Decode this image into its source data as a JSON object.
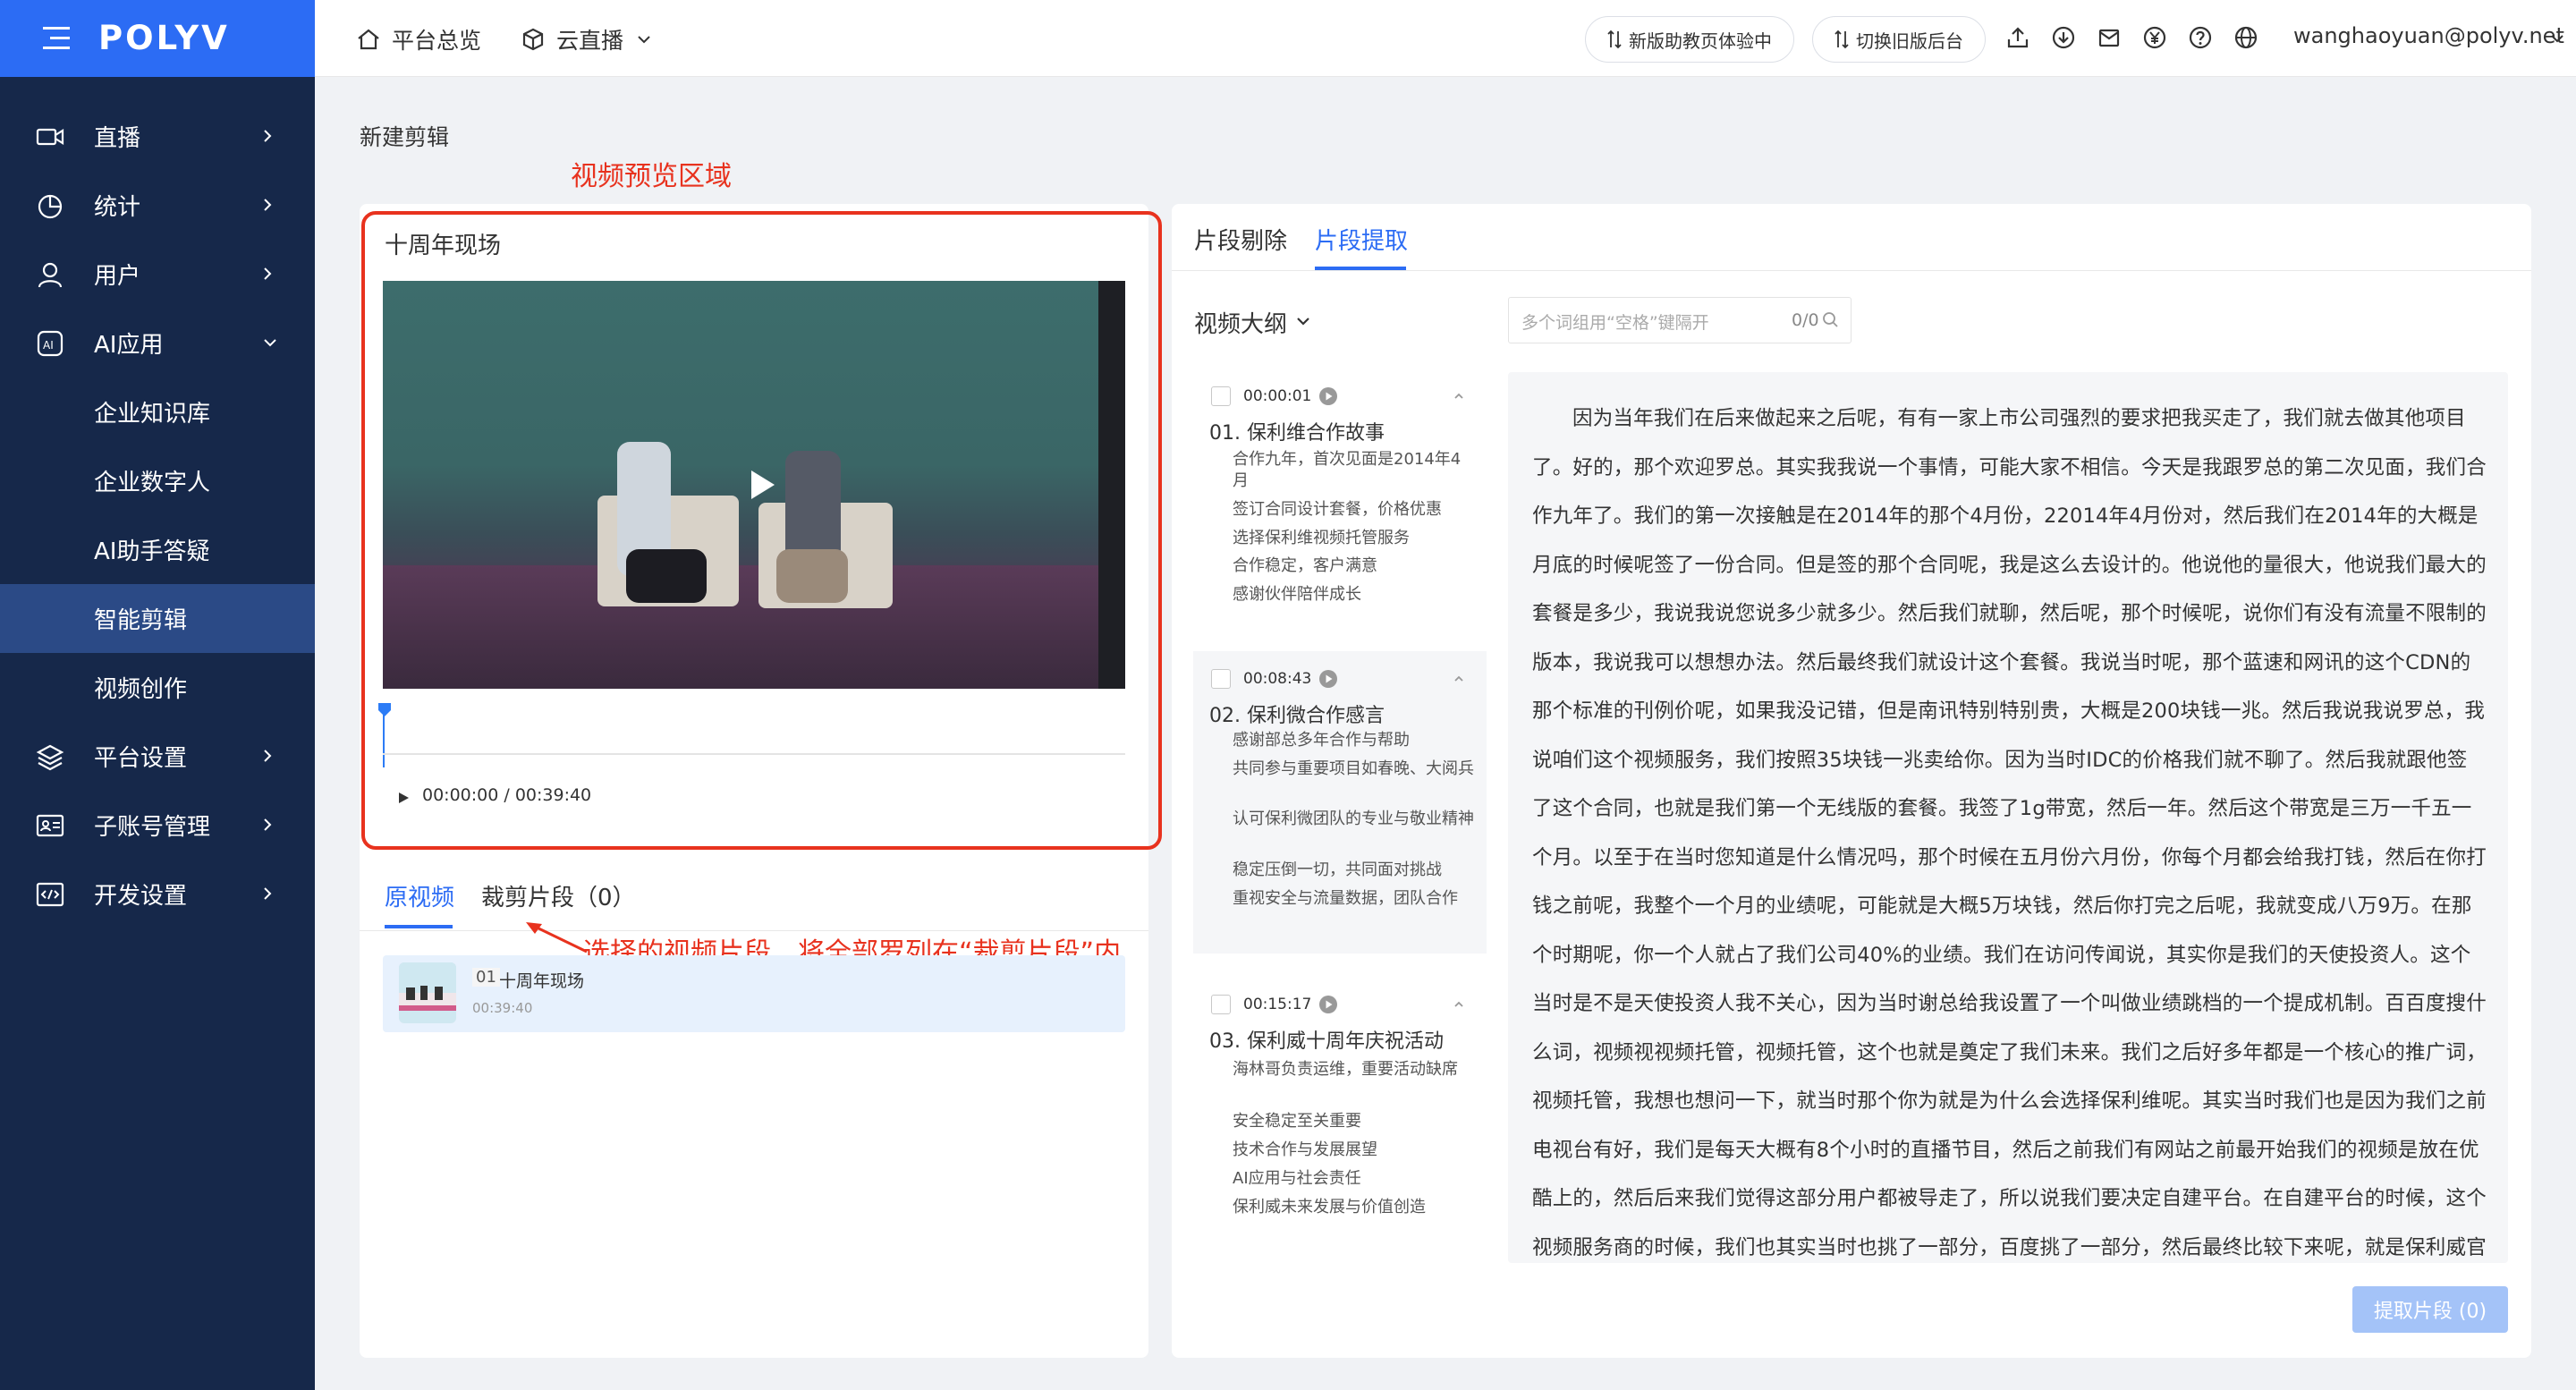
{
  "logo": "POLYV",
  "sidebar": {
    "items": [
      {
        "label": "直播"
      },
      {
        "label": "统计"
      },
      {
        "label": "用户"
      },
      {
        "label": "AI应用"
      },
      {
        "label": "企业知识库"
      },
      {
        "label": "企业数字人"
      },
      {
        "label": "AI助手答疑"
      },
      {
        "label": "智能剪辑"
      },
      {
        "label": "视频创作"
      },
      {
        "label": "平台设置"
      },
      {
        "label": "子账号管理"
      },
      {
        "label": "开发设置"
      }
    ],
    "active_item": "智能剪辑",
    "accent_color": "#2c6cf4",
    "bg_color": "#16284a"
  },
  "header": {
    "home": "平台总览",
    "cloud_live": "云直播",
    "new_home_btn": "新版助教页体验中",
    "switch_btn": "切换旧版后台",
    "email": "wanghaoyuan@polyv.net"
  },
  "page": {
    "title": "新建剪辑",
    "annotation_preview": "视频预览区域",
    "annotation_clips": "选择的视频片段，将全部罗列在“裁剪片段”内"
  },
  "player": {
    "video_title": "十周年现场",
    "timecode": "00:00:00 / 00:39:40",
    "progress": 0
  },
  "left_tabs": {
    "original": "原视频",
    "cut_clips": "裁剪片段（0）"
  },
  "clip": {
    "index": "01",
    "name": "十周年现场",
    "duration": "00:39:40"
  },
  "right_tabs": {
    "delete": "片段剔除",
    "extract": "片段提取"
  },
  "outline": {
    "title": "视频大纲",
    "search_placeholder": "多个词组用“空格”键隔开",
    "search_count": "0/0",
    "chapters": [
      {
        "time": "00:00:01",
        "title": "01. 保利维合作故事",
        "points": [
          "合作九年，首次见面是2014年4月",
          "签订合同设计套餐，价格优惠",
          "选择保利维视频托管服务",
          "合作稳定，客户满意",
          "感谢伙伴陪伴成长"
        ]
      },
      {
        "time": "00:08:43",
        "title": "02. 保利微合作感言",
        "points": [
          "感谢部总多年合作与帮助",
          "共同参与重要项目如春晚、大阅兵",
          "认可保利微团队的专业与敬业精神",
          "稳定压倒一切，共同面对挑战",
          "重视安全与流量数据，团队合作"
        ]
      },
      {
        "time": "00:15:17",
        "title": "03. 保利威十周年庆祝活动",
        "points": [
          "海林哥负责运维，重要活动缺席",
          "安全稳定至关重要",
          "技术合作与发展展望",
          "AI应用与社会责任",
          "保利威未来发展与价值创造"
        ]
      }
    ]
  },
  "transcript": {
    "text": "因为当年我们在后来做起来之后呢，有有一家上市公司强烈的要求把我买走了，我们就去做其他项目了。好的，那个欢迎罗总。其实我我说一个事情，可能大家不相信。今天是我跟罗总的第二次见面，我们合作九年了。我们的第一次接触是在2014年的那个4月份，22014年4月份对，然后我们在2014年的大概是月底的时候呢签了一份合同。但是签的那个合同呢，我是这么去设计的。他说他的量很大，他说我们最大的套餐是多少，我说我说您说多少就多少。然后我们就聊，然后呢，那个时候呢，说你们有没有流量不限制的版本，我说我可以想想办法。然后最终我们就设计这个套餐。我说当时呢，那个蓝速和网讯的这个CDN的那个标准的刊例价呢，如果我没记错，但是南讯特别特别贵，大概是200块钱一兆。然后我说我说罗总，我说咱们这个视频服务，我们按照35块钱一兆卖给你。因为当时IDC的价格我们就不聊了。然后我就跟他签了这个合同，也就是我们第一个无线版的套餐。我签了1g带宽，然后一年。然后这个带宽是三万一千五一个月。以至于在当时您知道是什么情况吗，那个时候在五月份六月份，你每个月都会给我打钱，然后在你打钱之前呢，我整个一个月的业绩呢，可能就是大概5万块钱，然后你打完之后呢，我就变成八万9万。在那个时期呢，你一个人就占了我们公司40%的业绩。我们在访问传闻说，其实你是我们的天使投资人。这个当时是不是天使投资人我不关心，因为当时谢总给我设置了一个叫做业绩跳档的一个提成机制。百百度搜什么词，视频视视频托管，视频托管，这个也就是奠定了我们未来。我们之后好多年都是一个核心的推广词，视频托管，我想也想问一下，就当时那个你为就是为什么会选择保利维呢。其实当时我们也是因为我们之前电视台有好，我们是每天大概有8个小时的直播节目，然后之前我们有网站之前最开始我们的视频是放在优酷上的，然后后来我们觉得这部分用户都被导走了，所以说我们要决定自建平台。在自建平台的时候，这个视频服务商的时候，我们也其实当时也挑了一部分，百度挑了一部分，然后最终比较下来呢，就是保利威官网写的最"
  },
  "extract_button": "提取片段 (0)",
  "colors": {
    "annotation": "#e8321e",
    "primary": "#2c6cf4",
    "disabled_primary": "#a4c3f8"
  }
}
